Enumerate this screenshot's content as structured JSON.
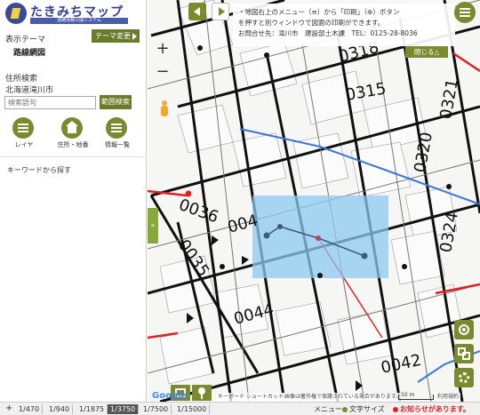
{
  "app": {
    "logo_title": "たきみちマップ",
    "logo_subtitle": "道路情報公開システム"
  },
  "sidebar": {
    "theme_label": "表示テーマ",
    "theme_change_button": "テーマ変更",
    "theme_name": "路線網図",
    "address_search_label": "住所検索",
    "city": "北海道滝川市",
    "search_placeholder": "検索語句",
    "range_search_button": "範囲検索",
    "buttons": [
      {
        "label": "レイヤ",
        "icon": "layers-icon"
      },
      {
        "label": "住所・地番",
        "icon": "house-icon"
      },
      {
        "label": "情報一覧",
        "icon": "list-icon"
      }
    ],
    "keyword_search_label": "キーワードから探す",
    "collapse_arrow": "«"
  },
  "map": {
    "notice_lines": [
      "・地図右上のメニュー（≡）から「印刷」（⊕）ボタン",
      "を押すと別ウィンドウで図面の印刷ができます。",
      "お問合せ先：滝川市　建設部土木課　TEL：0125-28-8036"
    ],
    "notice_close": "閉じる△",
    "zoom_in": "+",
    "zoom_out": "−",
    "road_labels": [
      "0318",
      "0315",
      "0321",
      "0320",
      "0036",
      "0035",
      "004",
      "0324",
      "0044",
      "0042"
    ],
    "google_logo": "Google",
    "attribution_shortcuts": "キーボード ショートカット",
    "attribution_data": "画像は著作権で保護されている場合があります。",
    "attribution_terms": "利用規約",
    "scale_label": "50 m",
    "colors": {
      "accent": "#7a8a2e",
      "highlight": "#8cc8f0",
      "road_red": "#e02020",
      "road_blue": "#3a78d8"
    }
  },
  "bottombar": {
    "plus": "+",
    "scales": [
      "1/470",
      "1/940",
      "1/1875",
      "1/3750",
      "1/7500",
      "1/15000"
    ],
    "active_scale": "1/3750",
    "menu_label": "メニュー",
    "font_size_label": "文字サイズ",
    "notice_label": "お知らせがあります。"
  }
}
